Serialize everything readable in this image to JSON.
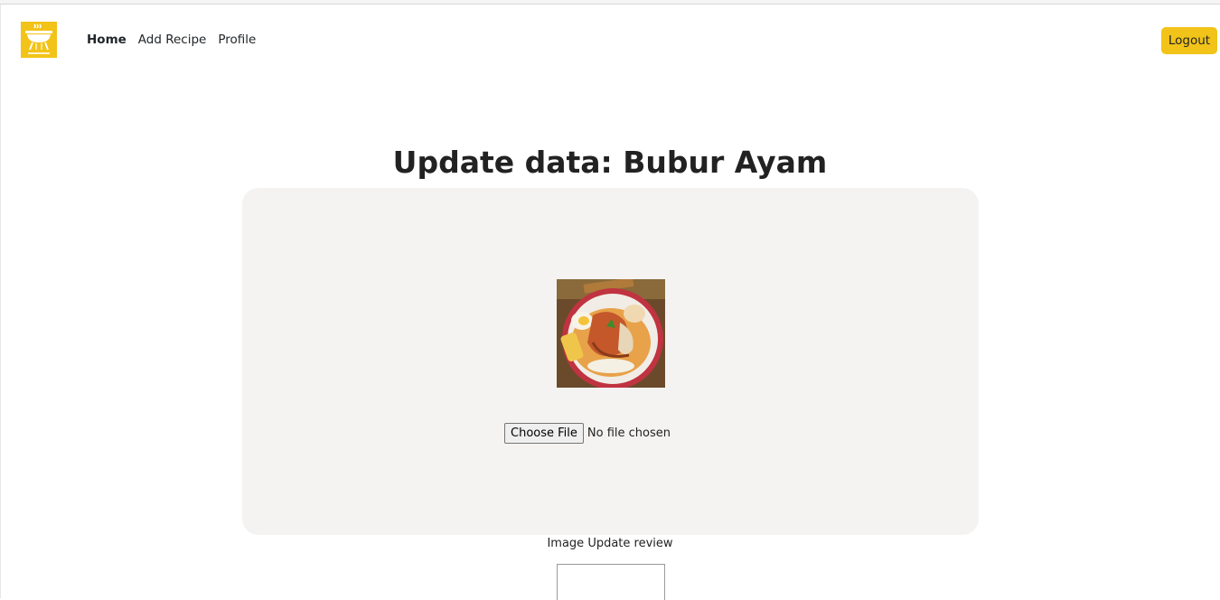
{
  "nav": {
    "links": [
      {
        "label": "Home",
        "active": true
      },
      {
        "label": "Add Recipe",
        "active": false
      },
      {
        "label": "Profile",
        "active": false
      }
    ],
    "logout_label": "Logout"
  },
  "page": {
    "title": "Update data: Bubur Ayam"
  },
  "upload": {
    "choose_file_label": "Choose File",
    "no_file_text": "No file chosen",
    "review_label": "Image Update review"
  },
  "colors": {
    "accent": "#f2c318",
    "card_bg": "#f4f3f2"
  },
  "icons": {
    "logo": "grill-logo-icon"
  }
}
